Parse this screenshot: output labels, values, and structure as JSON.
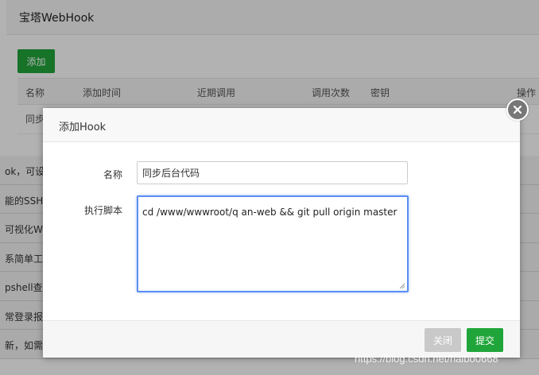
{
  "background": {
    "window_title": "宝塔WebHook",
    "add_label": "添加",
    "table_headers": [
      "名称",
      "添加时间",
      "近期调用",
      "调用次数",
      "密钥",
      "操作"
    ],
    "row_name": "同步",
    "list_snippets": [
      "ok，可设",
      "能的SSH",
      "可视化We",
      "系简单工",
      "pshell查",
      "常登录报",
      "新，如需"
    ]
  },
  "modal": {
    "title": "添加Hook",
    "name_label": "名称",
    "name_value": "同步后台代码",
    "script_label": "执行脚本",
    "script_value": "cd /www/wwwroot/q     an-web && git pull origin master",
    "close_label": "关闭",
    "submit_label": "提交"
  },
  "watermark": "https://blog.csdn.net/haibo0668",
  "colors": {
    "accent": "#20a53a",
    "focus": "#5b8ef1",
    "disabled": "#c9c9c9"
  }
}
